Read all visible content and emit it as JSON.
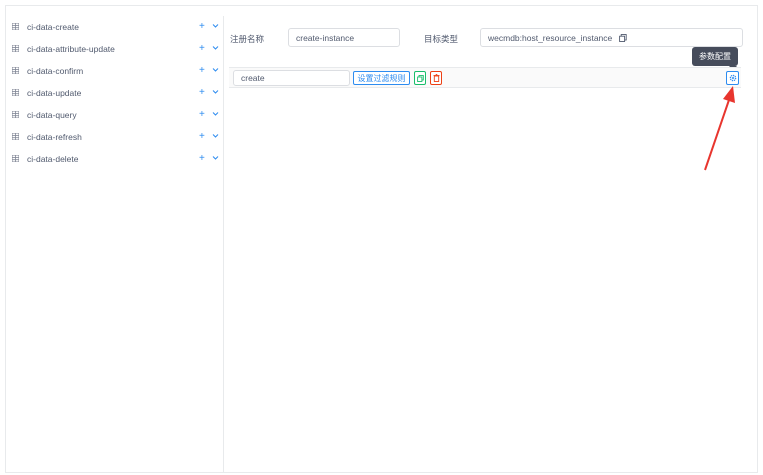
{
  "sidebar": {
    "items": [
      {
        "label": "ci-data-create"
      },
      {
        "label": "ci-data-attribute-update"
      },
      {
        "label": "ci-data-confirm"
      },
      {
        "label": "ci-data-update"
      },
      {
        "label": "ci-data-query"
      },
      {
        "label": "ci-data-refresh"
      },
      {
        "label": "ci-data-delete"
      }
    ],
    "add_symbol": "+",
    "item_icon": "grid-icon",
    "expand_icon": "chevron-down-icon"
  },
  "form": {
    "registration_name_label": "注册名称",
    "registration_name_value": "create-instance",
    "target_type_label": "目标类型",
    "target_type_value": "wecmdb:host_resource_instance"
  },
  "row": {
    "name_value": "create",
    "filter_button_label": "设置过滤规则",
    "copy_icon": "copy-icon",
    "delete_icon": "trash-icon",
    "settings_icon": "gear-icon"
  },
  "tooltip": {
    "text": "参数配置"
  },
  "colors": {
    "accent": "#2d8cf0",
    "success": "#19be6b",
    "danger": "#ed4014",
    "annotation_arrow": "#e8352e",
    "tooltip_bg": "#464c5b"
  }
}
